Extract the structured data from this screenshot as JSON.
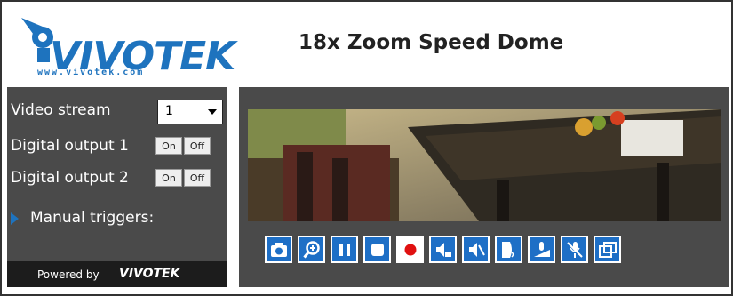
{
  "header": {
    "logo_text": "VIVOTEK",
    "logo_url": "www.vivotek.com",
    "title": "18x Zoom Speed Dome"
  },
  "left_panel": {
    "video_stream_label": "Video stream",
    "video_stream_value": "1",
    "digital_output_1_label": "Digital output 1",
    "digital_output_2_label": "Digital output 2",
    "on_label": "On",
    "off_label": "Off",
    "manual_triggers_label": "Manual triggers:"
  },
  "footer": {
    "powered_by": "Powered by",
    "brand": "VIVOTEK"
  },
  "toolbar": {
    "buttons": [
      "snapshot-icon",
      "zoom-in-icon",
      "pause-icon",
      "stop-icon",
      "record-icon",
      "volume-icon",
      "mute-icon",
      "talk-icon",
      "mic-volume-icon",
      "mic-mute-icon",
      "fullscreen-icon"
    ]
  },
  "colors": {
    "accent": "#1e73be",
    "panel": "#4a4a4a",
    "record": "#e01010"
  }
}
